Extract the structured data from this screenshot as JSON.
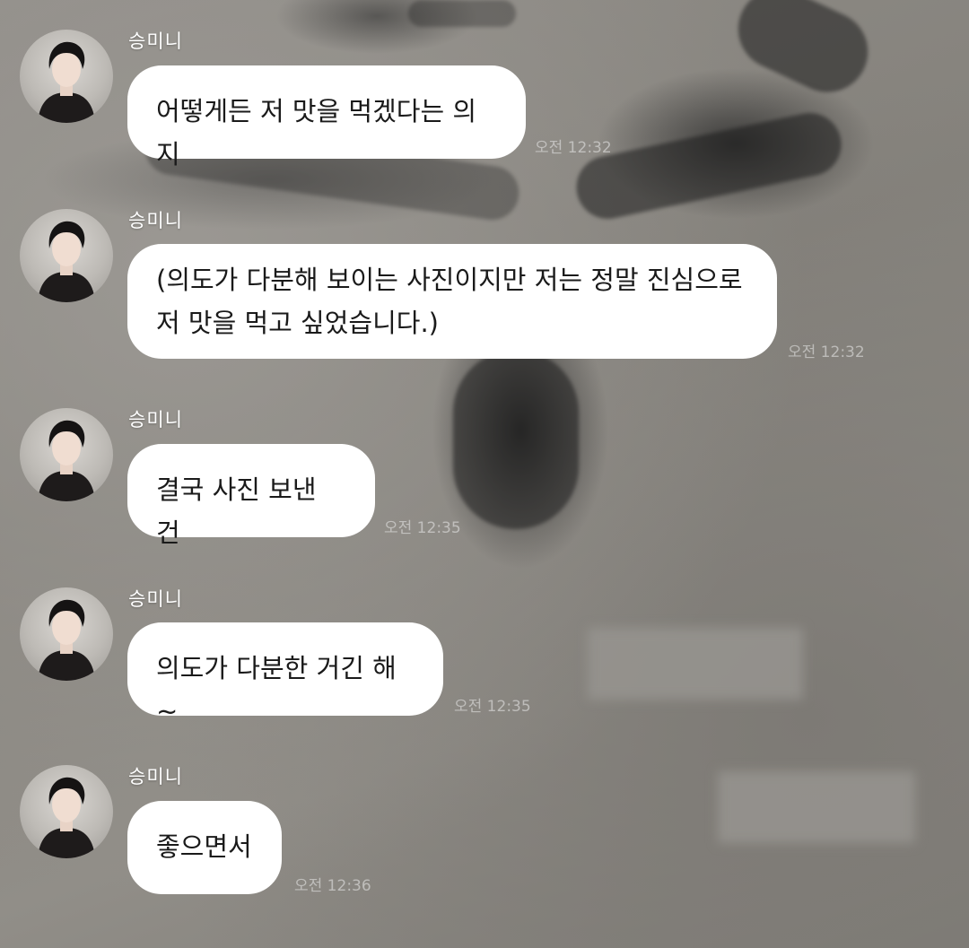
{
  "chat": {
    "messages": [
      {
        "sender": "승미니",
        "text": "어떻게든 저 맛을 먹겠다는 의지",
        "time": "오전 12:32"
      },
      {
        "sender": "승미니",
        "text": "(의도가 다분해 보이는 사진이지만 저는 정말 진심으로\n저 맛을 먹고 싶었습니다.)",
        "time": "오전 12:32"
      },
      {
        "sender": "승미니",
        "text": "결국 사진 보낸 건",
        "time": "오전 12:35"
      },
      {
        "sender": "승미니",
        "text": "의도가 다분한 거긴 해~",
        "time": "오전 12:35"
      },
      {
        "sender": "승미니",
        "text": "좋으면서",
        "time": "오전 12:36"
      }
    ]
  },
  "icons": {
    "avatar": "profile-photo"
  },
  "colors": {
    "bubble": "#ffffff",
    "bubble_text": "#1a1a1a",
    "sender_name": "#ffffff"
  }
}
